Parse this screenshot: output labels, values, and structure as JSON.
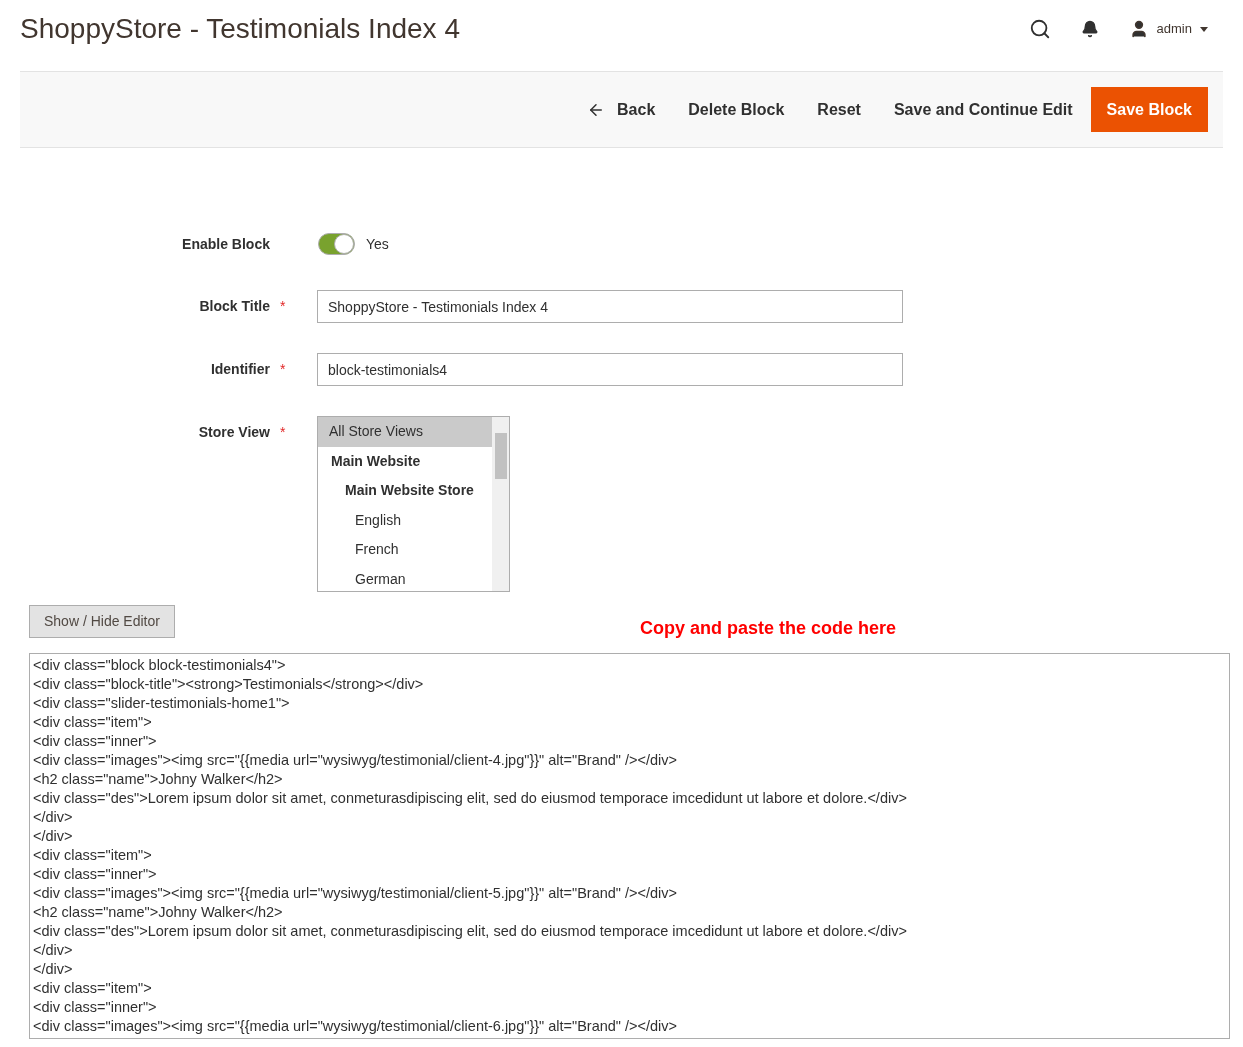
{
  "header": {
    "title": "ShoppyStore - Testimonials Index 4",
    "user": "admin"
  },
  "toolbar": {
    "buttons": [
      {
        "label": "Back",
        "kind": "back"
      },
      {
        "label": "Delete Block",
        "kind": "plain"
      },
      {
        "label": "Reset",
        "kind": "plain"
      },
      {
        "label": "Save and Continue Edit",
        "kind": "plain"
      },
      {
        "label": "Save Block",
        "kind": "primary"
      }
    ]
  },
  "form": {
    "enable_block": {
      "label": "Enable Block",
      "on": true,
      "value_label": "Yes"
    },
    "block_title": {
      "label": "Block Title",
      "required_mark": "*",
      "value": "ShoppyStore - Testimonials Index 4"
    },
    "identifier": {
      "label": "Identifier",
      "required_mark": "*",
      "value": "block-testimonials4"
    },
    "store_view": {
      "label": "Store View",
      "required_mark": "*",
      "options": [
        {
          "label": "All Store Views",
          "selected": true
        },
        {
          "label": "Main Website",
          "selected": false,
          "children": [
            {
              "label": "Main Website Store",
              "selected": false,
              "children": [
                {
                  "label": "English",
                  "selected": false
                },
                {
                  "label": "French",
                  "selected": false
                },
                {
                  "label": "German",
                  "selected": false
                }
              ]
            }
          ]
        }
      ]
    }
  },
  "editor": {
    "toggle_label": "Show / Hide Editor",
    "note": "Copy and paste the code here",
    "lines": [
      "<div class=\"block block-testimonials4\">",
      "<div class=\"block-title\"><strong>Testimonials</strong></div>",
      "<div class=\"slider-testimonials-home1\">",
      "<div class=\"item\">",
      "<div class=\"inner\">",
      "<div class=\"images\"><img src=\"{{media url=\"wysiwyg/testimonial/client-4.jpg\"}}\" alt=\"Brand\" /></div>",
      "<h2 class=\"name\">Johny Walker</h2>",
      "<div class=\"des\">Lorem ipsum dolor sit amet, conmeturasdipiscing elit, sed do eiusmod temporace imcedidunt ut labore et dolore.</div>",
      "</div>",
      "</div>",
      "<div class=\"item\">",
      "<div class=\"inner\">",
      "<div class=\"images\"><img src=\"{{media url=\"wysiwyg/testimonial/client-5.jpg\"}}\" alt=\"Brand\" /></div>",
      "<h2 class=\"name\">Johny Walker</h2>",
      "<div class=\"des\">Lorem ipsum dolor sit amet, conmeturasdipiscing elit, sed do eiusmod temporace imcedidunt ut labore et dolore.</div>",
      "</div>",
      "</div>",
      "<div class=\"item\">",
      "<div class=\"inner\">",
      "<div class=\"images\"><img src=\"{{media url=\"wysiwyg/testimonial/client-6.jpg\"}}\" alt=\"Brand\" /></div>"
    ]
  }
}
